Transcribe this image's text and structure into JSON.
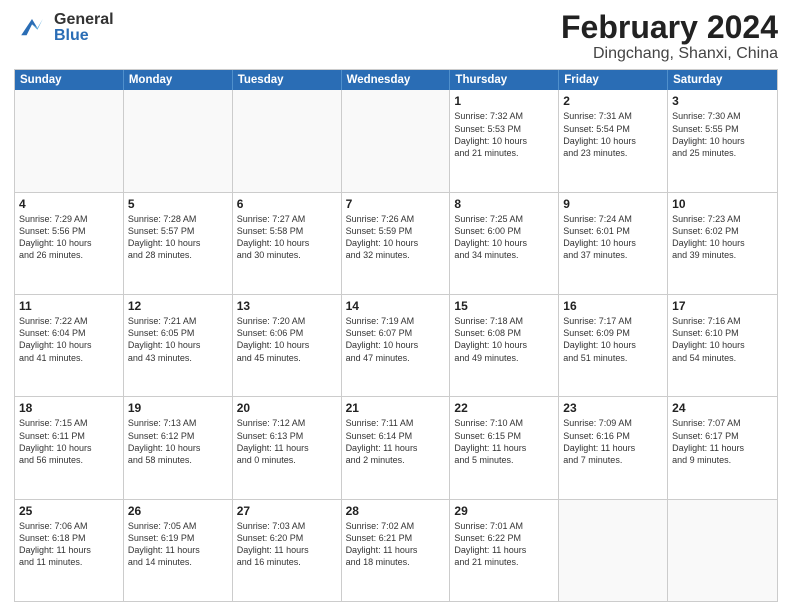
{
  "header": {
    "logo_general": "General",
    "logo_blue": "Blue",
    "main_title": "February 2024",
    "subtitle": "Dingchang, Shanxi, China"
  },
  "days_of_week": [
    "Sunday",
    "Monday",
    "Tuesday",
    "Wednesday",
    "Thursday",
    "Friday",
    "Saturday"
  ],
  "weeks": [
    [
      {
        "day": "",
        "info": ""
      },
      {
        "day": "",
        "info": ""
      },
      {
        "day": "",
        "info": ""
      },
      {
        "day": "",
        "info": ""
      },
      {
        "day": "1",
        "info": "Sunrise: 7:32 AM\nSunset: 5:53 PM\nDaylight: 10 hours\nand 21 minutes."
      },
      {
        "day": "2",
        "info": "Sunrise: 7:31 AM\nSunset: 5:54 PM\nDaylight: 10 hours\nand 23 minutes."
      },
      {
        "day": "3",
        "info": "Sunrise: 7:30 AM\nSunset: 5:55 PM\nDaylight: 10 hours\nand 25 minutes."
      }
    ],
    [
      {
        "day": "4",
        "info": "Sunrise: 7:29 AM\nSunset: 5:56 PM\nDaylight: 10 hours\nand 26 minutes."
      },
      {
        "day": "5",
        "info": "Sunrise: 7:28 AM\nSunset: 5:57 PM\nDaylight: 10 hours\nand 28 minutes."
      },
      {
        "day": "6",
        "info": "Sunrise: 7:27 AM\nSunset: 5:58 PM\nDaylight: 10 hours\nand 30 minutes."
      },
      {
        "day": "7",
        "info": "Sunrise: 7:26 AM\nSunset: 5:59 PM\nDaylight: 10 hours\nand 32 minutes."
      },
      {
        "day": "8",
        "info": "Sunrise: 7:25 AM\nSunset: 6:00 PM\nDaylight: 10 hours\nand 34 minutes."
      },
      {
        "day": "9",
        "info": "Sunrise: 7:24 AM\nSunset: 6:01 PM\nDaylight: 10 hours\nand 37 minutes."
      },
      {
        "day": "10",
        "info": "Sunrise: 7:23 AM\nSunset: 6:02 PM\nDaylight: 10 hours\nand 39 minutes."
      }
    ],
    [
      {
        "day": "11",
        "info": "Sunrise: 7:22 AM\nSunset: 6:04 PM\nDaylight: 10 hours\nand 41 minutes."
      },
      {
        "day": "12",
        "info": "Sunrise: 7:21 AM\nSunset: 6:05 PM\nDaylight: 10 hours\nand 43 minutes."
      },
      {
        "day": "13",
        "info": "Sunrise: 7:20 AM\nSunset: 6:06 PM\nDaylight: 10 hours\nand 45 minutes."
      },
      {
        "day": "14",
        "info": "Sunrise: 7:19 AM\nSunset: 6:07 PM\nDaylight: 10 hours\nand 47 minutes."
      },
      {
        "day": "15",
        "info": "Sunrise: 7:18 AM\nSunset: 6:08 PM\nDaylight: 10 hours\nand 49 minutes."
      },
      {
        "day": "16",
        "info": "Sunrise: 7:17 AM\nSunset: 6:09 PM\nDaylight: 10 hours\nand 51 minutes."
      },
      {
        "day": "17",
        "info": "Sunrise: 7:16 AM\nSunset: 6:10 PM\nDaylight: 10 hours\nand 54 minutes."
      }
    ],
    [
      {
        "day": "18",
        "info": "Sunrise: 7:15 AM\nSunset: 6:11 PM\nDaylight: 10 hours\nand 56 minutes."
      },
      {
        "day": "19",
        "info": "Sunrise: 7:13 AM\nSunset: 6:12 PM\nDaylight: 10 hours\nand 58 minutes."
      },
      {
        "day": "20",
        "info": "Sunrise: 7:12 AM\nSunset: 6:13 PM\nDaylight: 11 hours\nand 0 minutes."
      },
      {
        "day": "21",
        "info": "Sunrise: 7:11 AM\nSunset: 6:14 PM\nDaylight: 11 hours\nand 2 minutes."
      },
      {
        "day": "22",
        "info": "Sunrise: 7:10 AM\nSunset: 6:15 PM\nDaylight: 11 hours\nand 5 minutes."
      },
      {
        "day": "23",
        "info": "Sunrise: 7:09 AM\nSunset: 6:16 PM\nDaylight: 11 hours\nand 7 minutes."
      },
      {
        "day": "24",
        "info": "Sunrise: 7:07 AM\nSunset: 6:17 PM\nDaylight: 11 hours\nand 9 minutes."
      }
    ],
    [
      {
        "day": "25",
        "info": "Sunrise: 7:06 AM\nSunset: 6:18 PM\nDaylight: 11 hours\nand 11 minutes."
      },
      {
        "day": "26",
        "info": "Sunrise: 7:05 AM\nSunset: 6:19 PM\nDaylight: 11 hours\nand 14 minutes."
      },
      {
        "day": "27",
        "info": "Sunrise: 7:03 AM\nSunset: 6:20 PM\nDaylight: 11 hours\nand 16 minutes."
      },
      {
        "day": "28",
        "info": "Sunrise: 7:02 AM\nSunset: 6:21 PM\nDaylight: 11 hours\nand 18 minutes."
      },
      {
        "day": "29",
        "info": "Sunrise: 7:01 AM\nSunset: 6:22 PM\nDaylight: 11 hours\nand 21 minutes."
      },
      {
        "day": "",
        "info": ""
      },
      {
        "day": "",
        "info": ""
      }
    ]
  ]
}
